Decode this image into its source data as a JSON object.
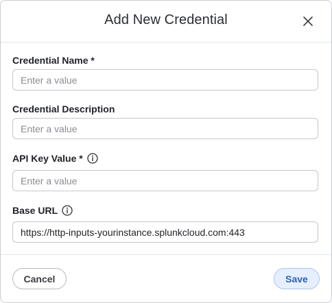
{
  "dialog": {
    "title": "Add New Credential",
    "close_icon": "close-icon"
  },
  "fields": {
    "credential_name": {
      "label": "Credential Name *",
      "placeholder": "Enter a value",
      "value": ""
    },
    "credential_description": {
      "label": "Credential Description",
      "placeholder": "Enter a value",
      "value": ""
    },
    "api_key_value": {
      "label": "API Key Value *",
      "placeholder": "Enter a value",
      "value": "",
      "icon": "info-icon"
    },
    "base_url": {
      "label": "Base URL",
      "placeholder": "",
      "value": "https://http-inputs-yourinstance.splunkcloud.com:443",
      "icon": "info-icon"
    }
  },
  "footer": {
    "cancel_label": "Cancel",
    "save_label": "Save"
  },
  "colors": {
    "primary_button_bg": "#e6efff",
    "primary_button_text": "#2f5fb3"
  }
}
